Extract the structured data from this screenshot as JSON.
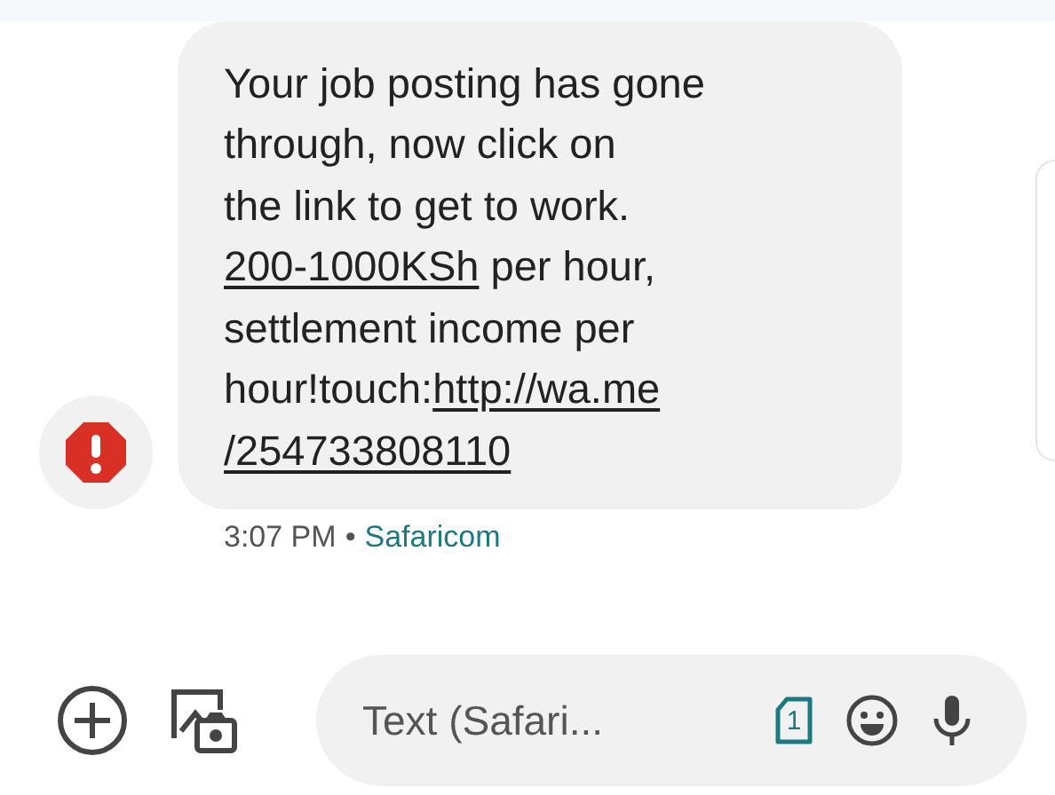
{
  "message": {
    "lines": [
      [
        {
          "text": "Your job posting has gone",
          "link": false
        }
      ],
      [
        {
          "text": "through, now click on",
          "link": false
        }
      ],
      [
        {
          "text": "the link to get to work.",
          "link": false
        }
      ],
      [
        {
          "text": "200-1000KSh",
          "link": true
        },
        {
          "text": " per hour,",
          "link": false
        }
      ],
      [
        {
          "text": "settlement income per",
          "link": false
        }
      ],
      [
        {
          "text": "hour!touch:",
          "link": false
        },
        {
          "text": "http://wa.me",
          "link": true
        }
      ],
      [
        {
          "text": "/254733808110",
          "link": true
        }
      ]
    ],
    "failed": true,
    "time": "3:07 PM",
    "separator": "•",
    "sender": "Safaricom"
  },
  "composer": {
    "placeholder": "Text (Safari...",
    "sim_number": "1"
  }
}
